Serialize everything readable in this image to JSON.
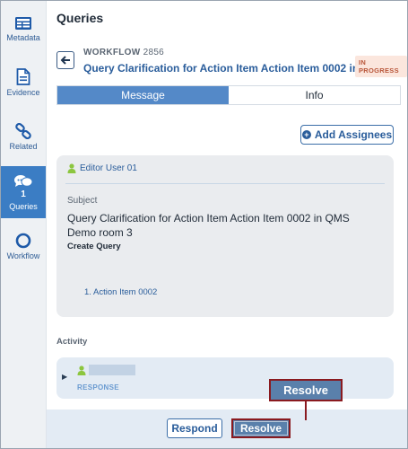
{
  "sidebar": {
    "items": [
      {
        "key": "metadata",
        "label": "Metadata",
        "icon": "metadata-icon"
      },
      {
        "key": "evidence",
        "label": "Evidence",
        "icon": "document-icon"
      },
      {
        "key": "related",
        "label": "Related",
        "icon": "link-icon"
      },
      {
        "key": "queries",
        "label": "Queries",
        "icon": "chat-bubbles-icon",
        "count": "1",
        "active": true
      },
      {
        "key": "workflow",
        "label": "Workflow",
        "icon": "circle-icon"
      }
    ]
  },
  "panel": {
    "title": "Queries",
    "workflow_label": "WORKFLOW",
    "workflow_number": "2856",
    "workflow_title": "Query Clarification for Action Item Action Item 0002 in ...",
    "status_badge": "IN PROGRESS"
  },
  "tabs": [
    {
      "label": "Message",
      "active": true
    },
    {
      "label": "Info",
      "active": false
    }
  ],
  "add_assignees_label": "Add Assignees",
  "query_card": {
    "user": "Editor User 01",
    "subject_label": "Subject",
    "subject": "Query Clarification for Action Item Action Item 0002 in QMS Demo room 3",
    "create_label": "Create Query",
    "action_items": [
      "1. Action Item 0002"
    ]
  },
  "activity": {
    "label": "Activity",
    "entry_type": "RESPONSE"
  },
  "footer": {
    "respond_label": "Respond",
    "resolve_label": "Resolve"
  },
  "callout_label": "Resolve",
  "colors": {
    "accent": "#5489c8",
    "sidebar_active": "#3b7dc4",
    "highlight_border": "#8a1a1f",
    "badge_text": "#b9573b",
    "badge_bg": "#fbe6dd"
  }
}
